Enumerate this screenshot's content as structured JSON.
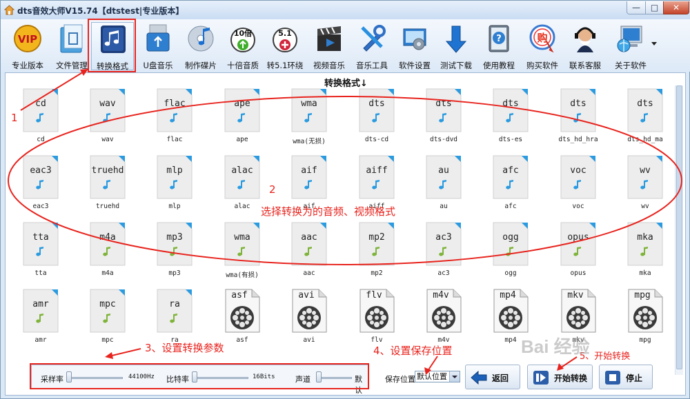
{
  "window": {
    "title": "dts音效大师V15.74【dtstest|专业版本】",
    "min": "—",
    "max": "□",
    "close": "✕"
  },
  "toolbar": [
    {
      "id": "vip",
      "label": "专业版本",
      "icon": "vip-badge-icon",
      "badge": "VIP"
    },
    {
      "id": "files",
      "label": "文件管理",
      "icon": "file-manager-icon"
    },
    {
      "id": "convert",
      "label": "转换格式",
      "icon": "music-note-icon",
      "selected": true
    },
    {
      "id": "usb",
      "label": "U盘音乐",
      "icon": "usb-drive-icon"
    },
    {
      "id": "disc",
      "label": "制作碟片",
      "icon": "music-disc-icon"
    },
    {
      "id": "boost",
      "label": "十倍音质",
      "icon": "ten-times-icon",
      "badge": "10倍"
    },
    {
      "id": "surround",
      "label": "转5.1环绕",
      "icon": "surround-51-icon",
      "badge": "5.1"
    },
    {
      "id": "video",
      "label": "视频音乐",
      "icon": "video-clapper-icon"
    },
    {
      "id": "tools",
      "label": "音乐工具",
      "icon": "tools-icon"
    },
    {
      "id": "settings",
      "label": "软件设置",
      "icon": "settings-icon"
    },
    {
      "id": "download",
      "label": "测试下载",
      "icon": "download-arrow-icon"
    },
    {
      "id": "tutorial",
      "label": "使用教程",
      "icon": "help-book-icon"
    },
    {
      "id": "buy",
      "label": "购买软件",
      "icon": "buy-icon",
      "badge": "购"
    },
    {
      "id": "support",
      "label": "联系客服",
      "icon": "headset-agent-icon"
    },
    {
      "id": "about",
      "label": "关于软件",
      "icon": "computer-globe-icon"
    }
  ],
  "section_title": "转换格式↓",
  "formats": [
    [
      {
        "ext": "cd",
        "caption": "cd",
        "type": "audio-blue"
      },
      {
        "ext": "wav",
        "caption": "wav",
        "type": "audio-blue"
      },
      {
        "ext": "flac",
        "caption": "flac",
        "type": "audio-blue"
      },
      {
        "ext": "ape",
        "caption": "ape",
        "type": "audio-blue"
      },
      {
        "ext": "wma",
        "caption": "wma(无损)",
        "type": "audio-blue"
      },
      {
        "ext": "dts",
        "caption": "dts-cd",
        "type": "audio-blue"
      },
      {
        "ext": "dts",
        "caption": "dts-dvd",
        "type": "audio-blue"
      },
      {
        "ext": "dts",
        "caption": "dts-es",
        "type": "audio-blue"
      },
      {
        "ext": "dts",
        "caption": "dts_hd_hra",
        "type": "audio-blue"
      },
      {
        "ext": "dts",
        "caption": "dts_hd_ma",
        "type": "audio-blue"
      }
    ],
    [
      {
        "ext": "eac3",
        "caption": "eac3",
        "type": "audio-blue"
      },
      {
        "ext": "truehd",
        "caption": "truehd",
        "type": "audio-blue"
      },
      {
        "ext": "mlp",
        "caption": "mlp",
        "type": "audio-blue"
      },
      {
        "ext": "alac",
        "caption": "alac",
        "type": "audio-blue"
      },
      {
        "ext": "aif",
        "caption": "aif",
        "type": "audio-blue"
      },
      {
        "ext": "aiff",
        "caption": "aiff",
        "type": "audio-blue"
      },
      {
        "ext": "au",
        "caption": "au",
        "type": "audio-blue"
      },
      {
        "ext": "afc",
        "caption": "afc",
        "type": "audio-blue"
      },
      {
        "ext": "voc",
        "caption": "voc",
        "type": "audio-blue"
      },
      {
        "ext": "wv",
        "caption": "wv",
        "type": "audio-blue"
      }
    ],
    [
      {
        "ext": "tta",
        "caption": "tta",
        "type": "audio-blue"
      },
      {
        "ext": "m4a",
        "caption": "m4a",
        "type": "audio-green"
      },
      {
        "ext": "mp3",
        "caption": "mp3",
        "type": "audio-green"
      },
      {
        "ext": "wma",
        "caption": "wma(有损)",
        "type": "audio-green"
      },
      {
        "ext": "aac",
        "caption": "aac",
        "type": "audio-green"
      },
      {
        "ext": "mp2",
        "caption": "mp2",
        "type": "audio-green"
      },
      {
        "ext": "ac3",
        "caption": "ac3",
        "type": "audio-green"
      },
      {
        "ext": "ogg",
        "caption": "ogg",
        "type": "audio-green"
      },
      {
        "ext": "opus",
        "caption": "opus",
        "type": "audio-green"
      },
      {
        "ext": "mka",
        "caption": "mka",
        "type": "audio-green"
      }
    ],
    [
      {
        "ext": "amr",
        "caption": "amr",
        "type": "audio-green"
      },
      {
        "ext": "mpc",
        "caption": "mpc",
        "type": "audio-green"
      },
      {
        "ext": "ra",
        "caption": "ra",
        "type": "audio-green"
      },
      {
        "ext": "asf",
        "caption": "asf",
        "type": "video"
      },
      {
        "ext": "avi",
        "caption": "avi",
        "type": "video"
      },
      {
        "ext": "flv",
        "caption": "flv",
        "type": "video"
      },
      {
        "ext": "m4v",
        "caption": "m4v",
        "type": "video"
      },
      {
        "ext": "mp4",
        "caption": "mp4",
        "type": "video"
      },
      {
        "ext": "mkv",
        "caption": "mkv",
        "type": "video"
      },
      {
        "ext": "mpg",
        "caption": "mpg",
        "type": "video"
      }
    ]
  ],
  "params": {
    "sample_rate_label": "采样率",
    "sample_rate_value": "44100Hz",
    "bitrate_label": "比特率",
    "bitrate_value": "16Bits",
    "channel_label": "声道",
    "channel_value": "默认"
  },
  "save": {
    "label": "保存位置",
    "value": "默认位置"
  },
  "buttons": {
    "back": "返回",
    "start": "开始转换",
    "stop": "停止"
  },
  "annotations": {
    "n1": "1",
    "n2": "2",
    "n2_text": "选择转换为的音频、视频格式",
    "n3_text": "3、设置转换参数",
    "n4_text": "4、设置保存位置",
    "n5_text": "5、开始转换"
  },
  "watermark": "Bai 经验",
  "colors": {
    "annotation_red": "#e8231d",
    "audio_blue_note": "#2a9be0",
    "audio_green_note": "#7fb43a",
    "video_reel": "#3a3a3a"
  }
}
